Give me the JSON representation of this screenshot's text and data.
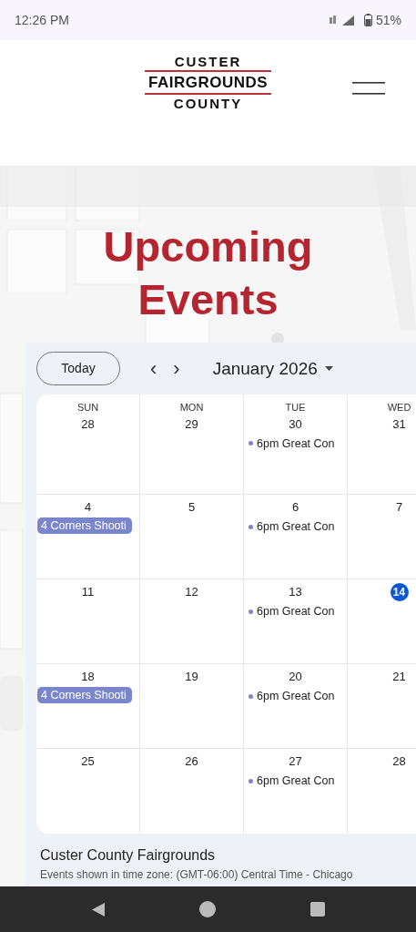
{
  "status_bar": {
    "time": "12:26 PM",
    "battery": "51%"
  },
  "header": {
    "logo": {
      "top": "CUSTER",
      "middle": "FAIRGROUNDS",
      "bottom": "COUNTY"
    }
  },
  "hero": {
    "title": "Upcoming Events"
  },
  "calendar": {
    "today_button": "Today",
    "prev": "‹",
    "next": "›",
    "month": "January 2026",
    "weekdays": [
      "SUN",
      "MON",
      "TUE",
      "WED"
    ],
    "weeks": [
      {
        "days": [
          {
            "day": "28",
            "today": false
          },
          {
            "day": "29",
            "today": false
          },
          {
            "day": "30",
            "today": false,
            "events": [
              {
                "kind": "timed",
                "time": "6pm",
                "title": "Great Con",
                "color": "#7986cb"
              }
            ]
          },
          {
            "day": "31",
            "today": false
          }
        ]
      },
      {
        "days": [
          {
            "day": "4",
            "today": false,
            "events": [
              {
                "kind": "allday",
                "title": "4 Corners Shooti",
                "color": "#7986cb"
              }
            ]
          },
          {
            "day": "5",
            "today": false
          },
          {
            "day": "6",
            "today": false,
            "events": [
              {
                "kind": "timed",
                "time": "6pm",
                "title": "Great Con",
                "color": "#7986cb"
              }
            ]
          },
          {
            "day": "7",
            "today": false
          }
        ]
      },
      {
        "days": [
          {
            "day": "11",
            "today": false
          },
          {
            "day": "12",
            "today": false
          },
          {
            "day": "13",
            "today": false,
            "events": [
              {
                "kind": "timed",
                "time": "6pm",
                "title": "Great Con",
                "color": "#7986cb"
              }
            ]
          },
          {
            "day": "14",
            "today": true
          }
        ]
      },
      {
        "days": [
          {
            "day": "18",
            "today": false,
            "events": [
              {
                "kind": "allday",
                "title": "4 Corners Shooti",
                "color": "#7986cb"
              }
            ]
          },
          {
            "day": "19",
            "today": false
          },
          {
            "day": "20",
            "today": false,
            "events": [
              {
                "kind": "timed",
                "time": "6pm",
                "title": "Great Con",
                "color": "#7986cb"
              }
            ]
          },
          {
            "day": "21",
            "today": false
          }
        ]
      },
      {
        "days": [
          {
            "day": "25",
            "today": false
          },
          {
            "day": "26",
            "today": false
          },
          {
            "day": "27",
            "today": false,
            "events": [
              {
                "kind": "timed",
                "time": "6pm",
                "title": "Great Con",
                "color": "#7986cb"
              }
            ]
          },
          {
            "day": "28",
            "today": false
          }
        ]
      }
    ],
    "footer": {
      "title": "Custer County Fairgrounds",
      "timezone": "Events shown in time zone: (GMT-06:00) Central Time - Chicago"
    }
  }
}
